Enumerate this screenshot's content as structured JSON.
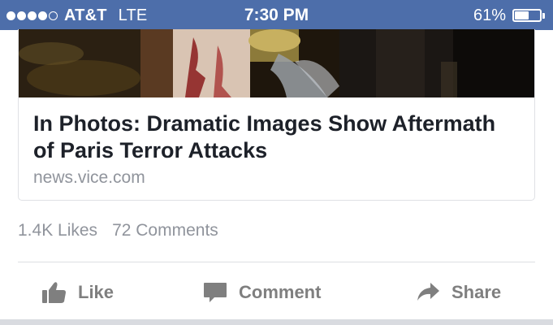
{
  "status_bar": {
    "signal_bars_filled": 4,
    "signal_bars_total": 5,
    "carrier": "AT&T",
    "network": "LTE",
    "time": "7:30 PM",
    "battery_percent_label": "61%",
    "battery_level": 0.61,
    "background_color": "#4d6eaa"
  },
  "post": {
    "link_card": {
      "headline": "In Photos: Dramatic Images Show Aftermath of Paris Terror Attacks",
      "domain": "news.vice.com"
    },
    "counts": {
      "likes": "1.4K Likes",
      "comments": "72 Comments"
    },
    "actions": {
      "like_label": "Like",
      "like_icon": "thumbs-up-icon",
      "comment_label": "Comment",
      "comment_icon": "speech-bubble-icon",
      "share_label": "Share",
      "share_icon": "share-arrow-icon"
    }
  }
}
